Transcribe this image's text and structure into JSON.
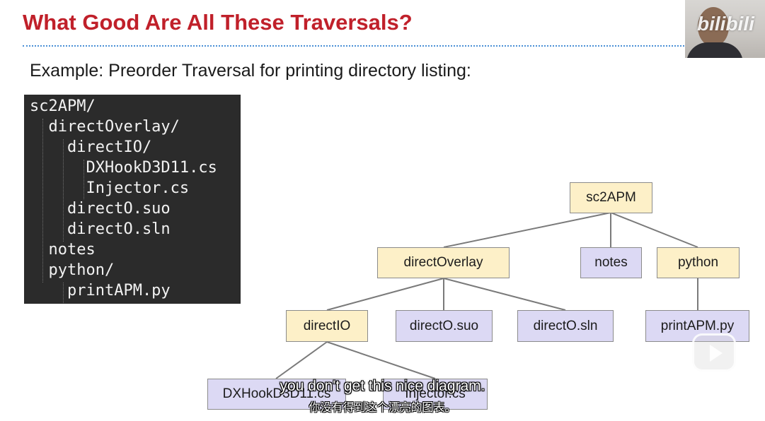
{
  "slide": {
    "title": "What Good Are All These Traversals?",
    "subtitle": "Example: Preorder Traversal for printing directory listing:"
  },
  "listing": [
    "sc2APM/",
    "  directOverlay/",
    "    directIO/",
    "      DXHookD3D11.cs",
    "      Injector.cs",
    "    directO.suo",
    "    directO.sln",
    "  notes",
    "  python/",
    "    printAPM.py"
  ],
  "tree": {
    "root": "sc2APM",
    "directOverlay": "directOverlay",
    "notes": "notes",
    "python": "python",
    "directIO": "directIO",
    "suo": "directO.suo",
    "sln": "directO.sln",
    "printapm": "printAPM.py",
    "dxhook": "DXHookD3D11.cs",
    "injector": "Injector.cs"
  },
  "colors": {
    "title": "#c0202a",
    "directory_node": "#fdf0c8",
    "file_node": "#dcd9f4"
  },
  "player": {
    "logo": "bilibili",
    "play_icon": "play-icon"
  },
  "subtitles": {
    "english": "you don't get this nice diagram.",
    "chinese": "你没有得到这个漂亮的图表。"
  }
}
